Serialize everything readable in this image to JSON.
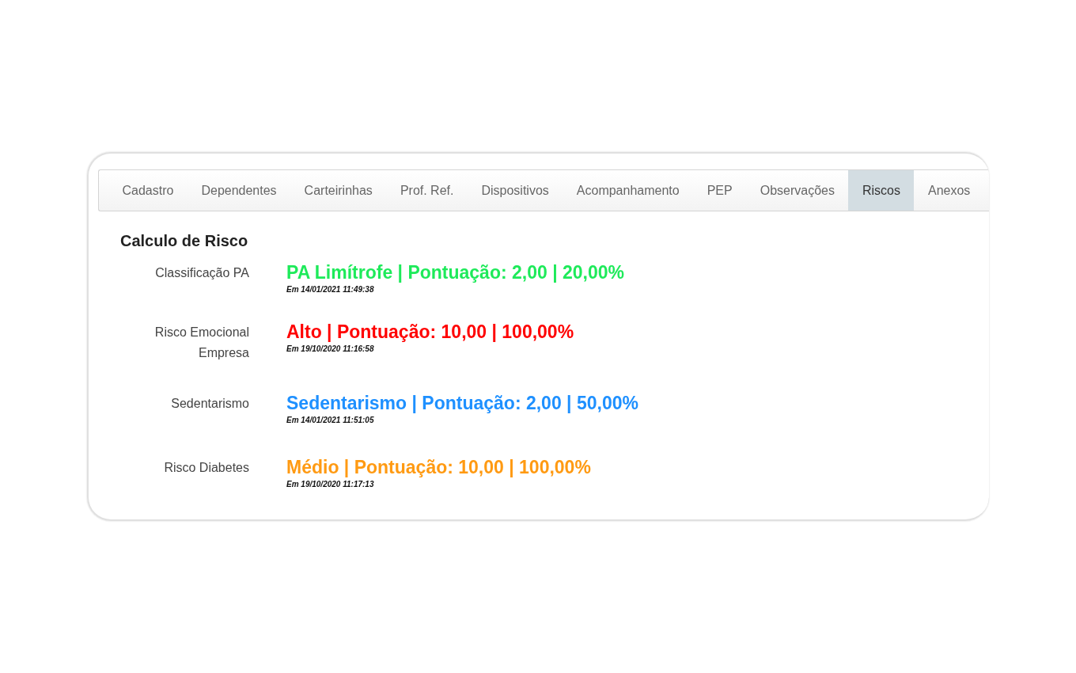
{
  "tabs": [
    {
      "label": "Cadastro",
      "selected": false
    },
    {
      "label": "Dependentes",
      "selected": false
    },
    {
      "label": "Carteirinhas",
      "selected": false
    },
    {
      "label": "Prof. Ref.",
      "selected": false
    },
    {
      "label": "Dispositivos",
      "selected": false
    },
    {
      "label": "Acompanhamento",
      "selected": false
    },
    {
      "label": "PEP",
      "selected": false
    },
    {
      "label": "Observações",
      "selected": false
    },
    {
      "label": "Riscos",
      "selected": true
    },
    {
      "label": "Anexos",
      "selected": false
    }
  ],
  "section_title": "Calculo de Risco",
  "risks": [
    {
      "label": "Classificação PA",
      "result": "PA Limítrofe | Pontuação: 2,00 | 20,00%",
      "date": "Em 14/01/2021 11:49:38",
      "color": "#1eea5a"
    },
    {
      "label": "Risco Emocional Empresa",
      "result": "Alto | Pontuação: 10,00 | 100,00%",
      "date": "Em 19/10/2020 11:16:58",
      "color": "#ff0000"
    },
    {
      "label": "Sedentarismo",
      "result": "Sedentarismo | Pontuação: 2,00 | 50,00%",
      "date": "Em 14/01/2021 11:51:05",
      "color": "#1e90ff"
    },
    {
      "label": "Risco Diabetes",
      "result": "Médio | Pontuação: 10,00 | 100,00%",
      "date": "Em 19/10/2020 11:17:13",
      "color": "#ff9a12"
    }
  ]
}
